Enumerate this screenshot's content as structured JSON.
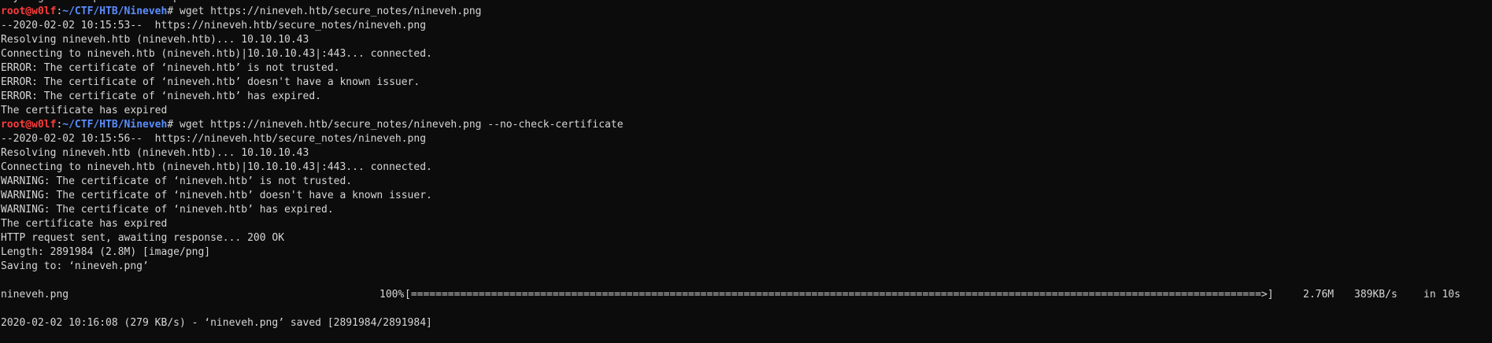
{
  "terminal": {
    "lines": [
      {
        "text": "Try `wget --help' for more options."
      },
      {
        "prompt": {
          "user": "root@w0lf",
          "path": "~/CTF/HTB/Nineveh",
          "sym": "#"
        },
        "cmd": " wget https://nineveh.htb/secure_notes/nineveh.png"
      },
      {
        "text": "--2020-02-02 10:15:53--  https://nineveh.htb/secure_notes/nineveh.png"
      },
      {
        "text": "Resolving nineveh.htb (nineveh.htb)... 10.10.10.43"
      },
      {
        "text": "Connecting to nineveh.htb (nineveh.htb)|10.10.10.43|:443... connected."
      },
      {
        "text": "ERROR: The certificate of ‘nineveh.htb’ is not trusted."
      },
      {
        "text": "ERROR: The certificate of ‘nineveh.htb’ doesn't have a known issuer."
      },
      {
        "text": "ERROR: The certificate of ‘nineveh.htb’ has expired."
      },
      {
        "text": "The certificate has expired"
      },
      {
        "prompt": {
          "user": "root@w0lf",
          "path": "~/CTF/HTB/Nineveh",
          "sym": "#"
        },
        "cmd": " wget https://nineveh.htb/secure_notes/nineveh.png --no-check-certificate"
      },
      {
        "text": "--2020-02-02 10:15:56--  https://nineveh.htb/secure_notes/nineveh.png"
      },
      {
        "text": "Resolving nineveh.htb (nineveh.htb)... 10.10.10.43"
      },
      {
        "text": "Connecting to nineveh.htb (nineveh.htb)|10.10.10.43|:443... connected."
      },
      {
        "text": "WARNING: The certificate of ‘nineveh.htb’ is not trusted."
      },
      {
        "text": "WARNING: The certificate of ‘nineveh.htb’ doesn't have a known issuer."
      },
      {
        "text": "WARNING: The certificate of ‘nineveh.htb’ has expired."
      },
      {
        "text": "The certificate has expired"
      },
      {
        "text": "HTTP request sent, awaiting response... 200 OK"
      },
      {
        "text": "Length: 2891984 (2.8M) [image/png]"
      },
      {
        "text": "Saving to: ‘nineveh.png’"
      },
      {
        "text": ""
      },
      {
        "progress": {
          "file": "nineveh.png",
          "percent": "100%",
          "bar": "[==========================================================================================================================================>]",
          "size": "2.76M",
          "rate": "389KB/s",
          "eta": "in 10s"
        }
      },
      {
        "text": ""
      },
      {
        "text": "2020-02-02 10:16:08 (279 KB/s) - ‘nineveh.png’ saved [2891984/2891984]"
      }
    ]
  },
  "colors": {
    "background": "#0c0c0c",
    "text": "#d6d6d6",
    "prompt_user": "#ff3b3b",
    "prompt_path": "#5a8dff"
  }
}
